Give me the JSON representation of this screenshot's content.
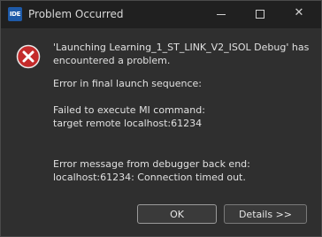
{
  "window": {
    "app_icon_label": "IDE",
    "title": "Problem Occurred"
  },
  "title_controls": {
    "minimize": "minimize",
    "maximize": "maximize",
    "close": "close"
  },
  "dialog": {
    "icon": "error-icon",
    "icon_color": "#c42b2b",
    "message_line1": "'Launching Learning_1_ST_LINK_V2_ISOL Debug' has",
    "message_line2": "encountered a problem.",
    "detail_line1": "Error in final launch sequence:",
    "detail_line2": "Failed to execute MI command:",
    "detail_line3": "target remote localhost:61234",
    "detail_line4": "Error message from debugger back end:",
    "detail_line5": "localhost:61234: Connection timed out."
  },
  "buttons": {
    "ok_label": "OK",
    "details_label": "Details >>"
  },
  "colors": {
    "background": "#2f2f2f",
    "titlebar": "#202020",
    "text": "#e0e0e0"
  }
}
